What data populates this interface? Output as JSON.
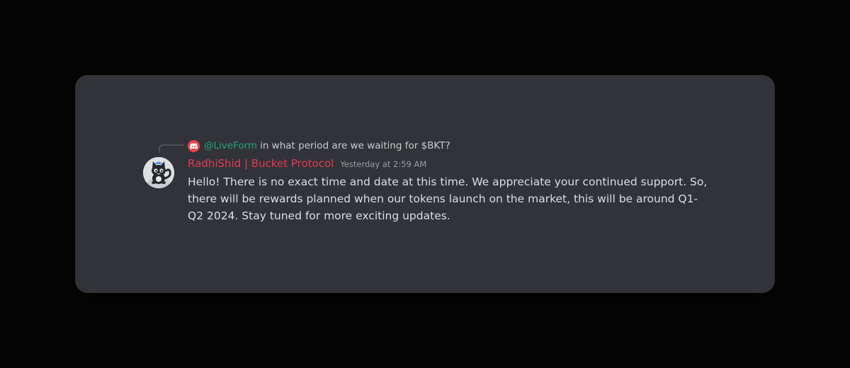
{
  "reply": {
    "mention": "@LiveForm",
    "text": "in what period are we waiting for $BKT?",
    "avatar_icon": "discord-logo-icon",
    "avatar_color": "#e8434b"
  },
  "message": {
    "author": "RadhiShid | Bucket Protocol",
    "author_color": "#e23a58",
    "timestamp": "Yesterday at 2:59 AM",
    "avatar_icon": "cat-character-avatar",
    "content": "Hello! There is no exact time and date at this time. We appreciate your continued support. So, there will be rewards planned when our tokens launch on the market, this will be around Q1-Q2 2024. Stay tuned for more exciting updates."
  },
  "colors": {
    "page_background": "#050505",
    "card_background": "#313338",
    "mention": "#1fa67a",
    "text": "#dcdde1",
    "muted": "#9a9ca3"
  }
}
